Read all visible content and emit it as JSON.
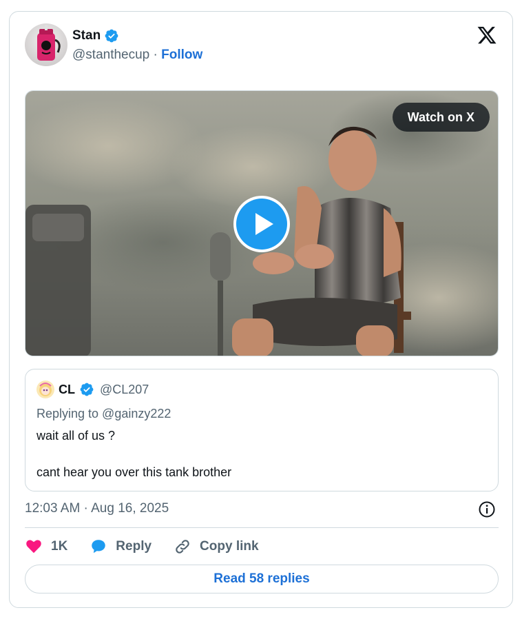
{
  "author": {
    "name": "Stan",
    "handle": "@stanthecup",
    "separator": "·",
    "follow_label": "Follow",
    "verified": true
  },
  "video": {
    "watch_label": "Watch on X"
  },
  "quoted_tweet": {
    "name": "CL",
    "handle": "@CL207",
    "replying_to": "Replying to @gainzy222",
    "text_line1": "wait all of us ?",
    "text_line2": "cant hear you over this tank brother"
  },
  "timestamp": "12:03 AM · Aug 16, 2025",
  "actions": {
    "like_count": "1K",
    "reply_label": "Reply",
    "copy_link_label": "Copy link"
  },
  "read_replies_label": "Read 58 replies",
  "icons": {
    "logo": "x-logo-icon",
    "verified": "verified-badge-icon",
    "play": "play-icon",
    "info": "info-icon",
    "like": "heart-icon",
    "reply": "speech-bubble-icon",
    "copy": "link-icon"
  },
  "colors": {
    "accent_blue": "#1d70d6",
    "verified_blue": "#1d9bf0",
    "like_pink": "#f91880",
    "muted_text": "#536471",
    "border": "#cfd9de"
  }
}
